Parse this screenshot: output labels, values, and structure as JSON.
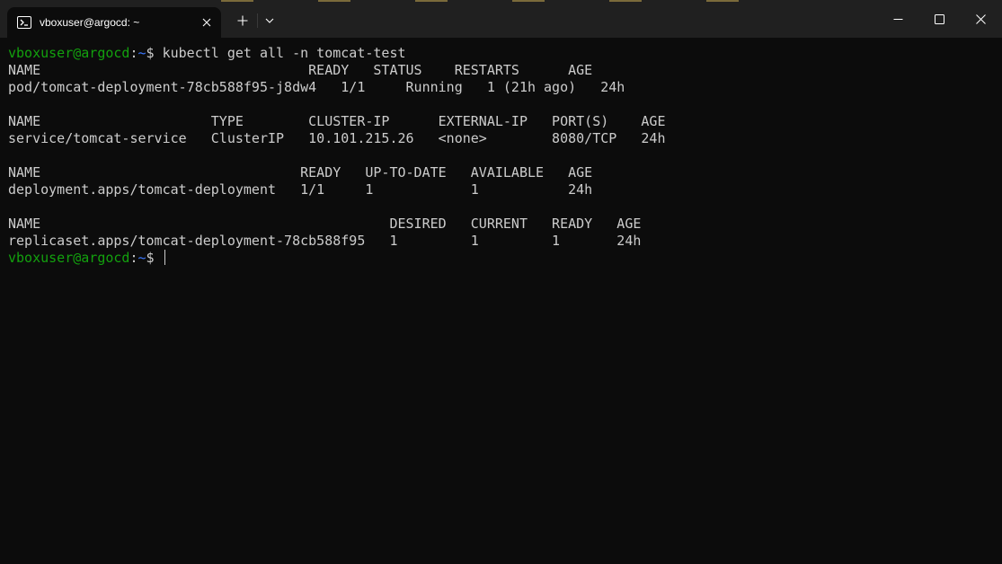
{
  "tab": {
    "title": "vboxuser@argocd: ~",
    "icon": "powershell-icon"
  },
  "window_controls": {
    "minimize": "minimize-icon",
    "maximize": "maximize-icon",
    "close": "close-icon"
  },
  "prompt": {
    "user_host": "vboxuser@argocd",
    "separator": ":",
    "path": "~",
    "symbol": "$ "
  },
  "command": "kubectl get all -n tomcat-test",
  "output_lines": [
    "NAME                                 READY   STATUS    RESTARTS      AGE",
    "pod/tomcat-deployment-78cb588f95-j8dw4   1/1     Running   1 (21h ago)   24h",
    "",
    "NAME                     TYPE        CLUSTER-IP      EXTERNAL-IP   PORT(S)    AGE",
    "service/tomcat-service   ClusterIP   10.101.215.26   <none>        8080/TCP   24h",
    "",
    "NAME                                READY   UP-TO-DATE   AVAILABLE   AGE",
    "deployment.apps/tomcat-deployment   1/1     1            1           24h",
    "",
    "NAME                                           DESIRED   CURRENT   READY   AGE",
    "replicaset.apps/tomcat-deployment-78cb588f95   1         1         1       24h"
  ],
  "colors": {
    "background": "#0c0c0c",
    "titlebar": "#202020",
    "text": "#cccccc",
    "prompt_user": "#13a10e",
    "prompt_path": "#3b78ff"
  }
}
